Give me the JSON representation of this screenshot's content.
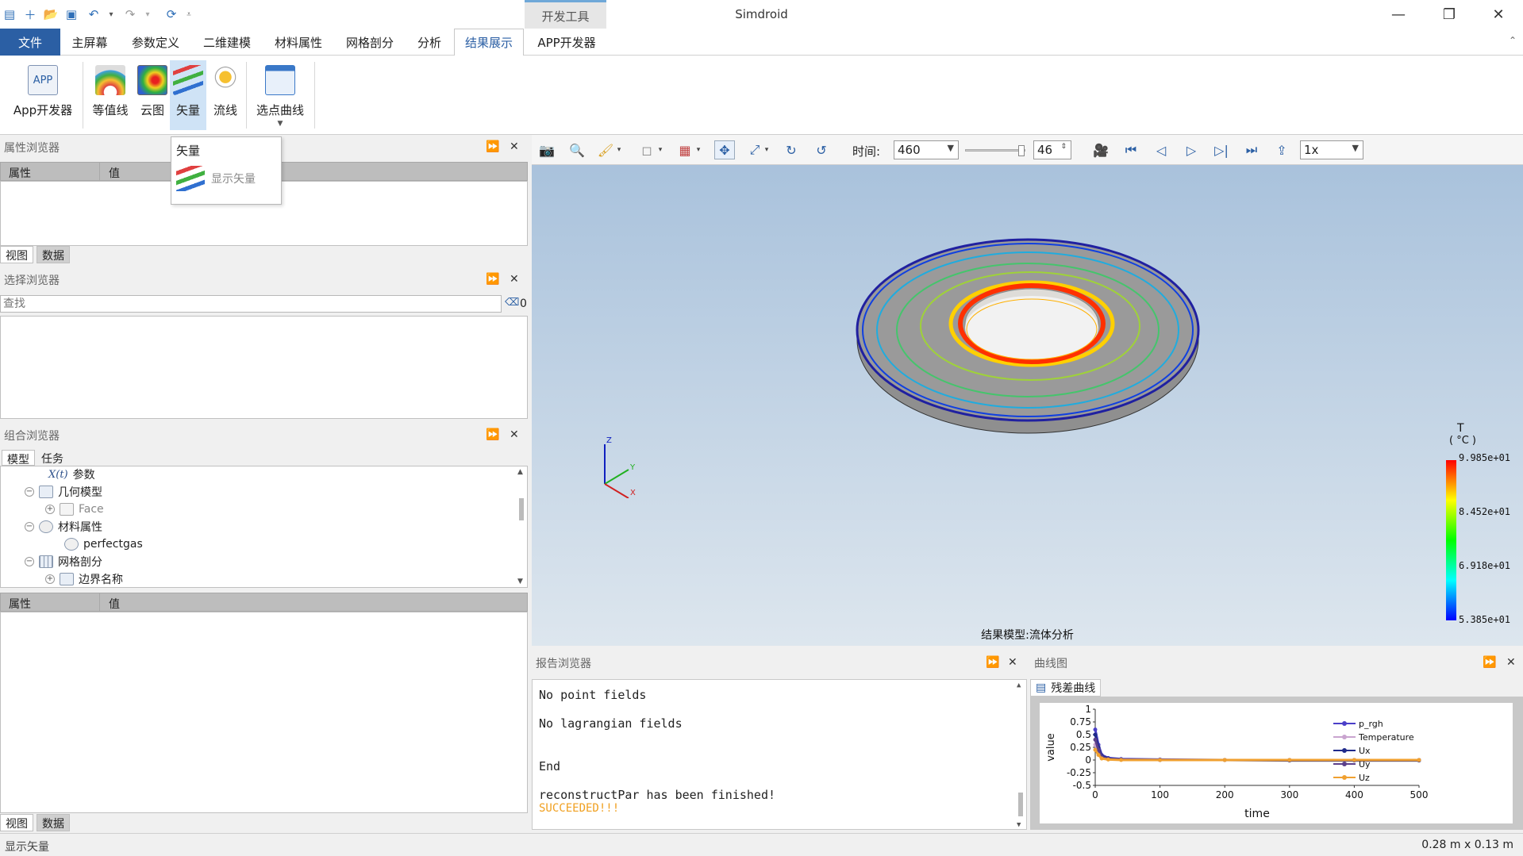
{
  "app": {
    "title": "Simdroid",
    "devtools_tab": "开发工具"
  },
  "menu": {
    "tabs": [
      "文件",
      "主屏幕",
      "参数定义",
      "二维建模",
      "材料属性",
      "网格剖分",
      "分析",
      "结果展示",
      "APP开发器"
    ],
    "active": "结果展示"
  },
  "ribbon": {
    "buttons": [
      {
        "label": "App开发器",
        "icon": "app-icon"
      },
      {
        "label": "等值线",
        "icon": "contour-icon"
      },
      {
        "label": "云图",
        "icon": "cloud-map-icon"
      },
      {
        "label": "矢量",
        "icon": "vector-icon"
      },
      {
        "label": "流线",
        "icon": "streamline-icon"
      },
      {
        "label": "选点曲线",
        "icon": "point-curve-icon"
      }
    ]
  },
  "vector_popup": {
    "title": "矢量",
    "item": "显示矢量"
  },
  "property_browser": {
    "title": "属性浏览器",
    "col_property": "属性",
    "col_value": "值",
    "tabs": [
      "视图",
      "数据"
    ]
  },
  "selection_browser": {
    "title": "选择浏览器",
    "search_placeholder": "查找",
    "count": "0"
  },
  "combo_browser": {
    "title": "组合浏览器",
    "tabs": [
      "模型",
      "任务"
    ],
    "tree": [
      {
        "label": "参数",
        "prefix": "X(t)",
        "toggle": ""
      },
      {
        "label": "几何模型",
        "toggle": "⊖"
      },
      {
        "label": "Face",
        "toggle": "⊕"
      },
      {
        "label": "材料属性",
        "toggle": "⊖"
      },
      {
        "label": "perfectgas",
        "toggle": ""
      },
      {
        "label": "网格剖分",
        "toggle": "⊖"
      },
      {
        "label": "边界名称",
        "toggle": "⊕"
      }
    ],
    "col_property": "属性",
    "col_value": "值",
    "bottom_tabs": [
      "视图",
      "数据"
    ]
  },
  "viewer_toolbar": {
    "time_label": "时间:",
    "time_value": "460",
    "step_value": "46",
    "speed_value": "1x"
  },
  "legend": {
    "title": "T",
    "unit": "( °C )",
    "labels": [
      "9.985e+01",
      "8.452e+01",
      "6.918e+01",
      "5.385e+01"
    ],
    "colors": [
      "#ff0000",
      "#ffff00",
      "#00ff00",
      "#00ffff",
      "#0000ff"
    ]
  },
  "result_model": "结果模型:流体分析",
  "report_browser": {
    "title": "报告浏览器",
    "lines": [
      "No point fields",
      "No lagrangian fields",
      "End",
      "reconstructPar has been finished!",
      "SUCCEEDED!!!"
    ]
  },
  "curve_panel": {
    "title": "曲线图",
    "tab": "残差曲线"
  },
  "chart_data": {
    "type": "line",
    "xlabel": "time",
    "ylabel": "value",
    "xlim": [
      0,
      500
    ],
    "ylim": [
      -0.5,
      1
    ],
    "xticks": [
      0,
      100,
      200,
      300,
      400,
      500
    ],
    "yticks": [
      "1",
      "0.75",
      "0.5",
      "0.25",
      "0",
      "-0.25",
      "-0.5"
    ],
    "series": [
      {
        "name": "p_rgh",
        "color": "#4b3fc8",
        "x": [
          0,
          5,
          10,
          20,
          40,
          100,
          200,
          300,
          400,
          500
        ],
        "values": [
          0.6,
          0.3,
          0.1,
          0.04,
          0.02,
          0.01,
          0.0,
          0.0,
          0.0,
          0.0
        ]
      },
      {
        "name": "Temperature",
        "color": "#c9a4cf",
        "x": [
          0,
          5,
          10,
          20,
          40,
          100,
          200,
          300,
          400,
          500
        ],
        "values": [
          0.3,
          0.15,
          0.05,
          0.02,
          0.01,
          0.0,
          0.0,
          0.0,
          0.0,
          0.0
        ]
      },
      {
        "name": "Ux",
        "color": "#1f2a8a",
        "x": [
          0,
          5,
          10,
          20,
          40,
          100,
          200,
          300,
          400,
          500
        ],
        "values": [
          0.5,
          0.25,
          0.08,
          0.03,
          0.01,
          0.0,
          0.0,
          -0.01,
          -0.01,
          -0.01
        ]
      },
      {
        "name": "Uy",
        "color": "#5b3f8a",
        "x": [
          0,
          5,
          10,
          20,
          40,
          100,
          200,
          300,
          400,
          500
        ],
        "values": [
          0.4,
          0.2,
          0.06,
          0.02,
          0.01,
          0.0,
          0.0,
          0.0,
          0.0,
          0.0
        ]
      },
      {
        "name": "Uz",
        "color": "#f0a030",
        "x": [
          0,
          5,
          10,
          20,
          40,
          100,
          200,
          300,
          400,
          500
        ],
        "values": [
          0.2,
          0.1,
          0.03,
          0.01,
          0.0,
          0.0,
          0.0,
          0.0,
          0.0,
          0.0
        ]
      }
    ],
    "legend_position": "right"
  },
  "status": {
    "left": "显示矢量",
    "right": "0.28 m x 0.13 m"
  }
}
